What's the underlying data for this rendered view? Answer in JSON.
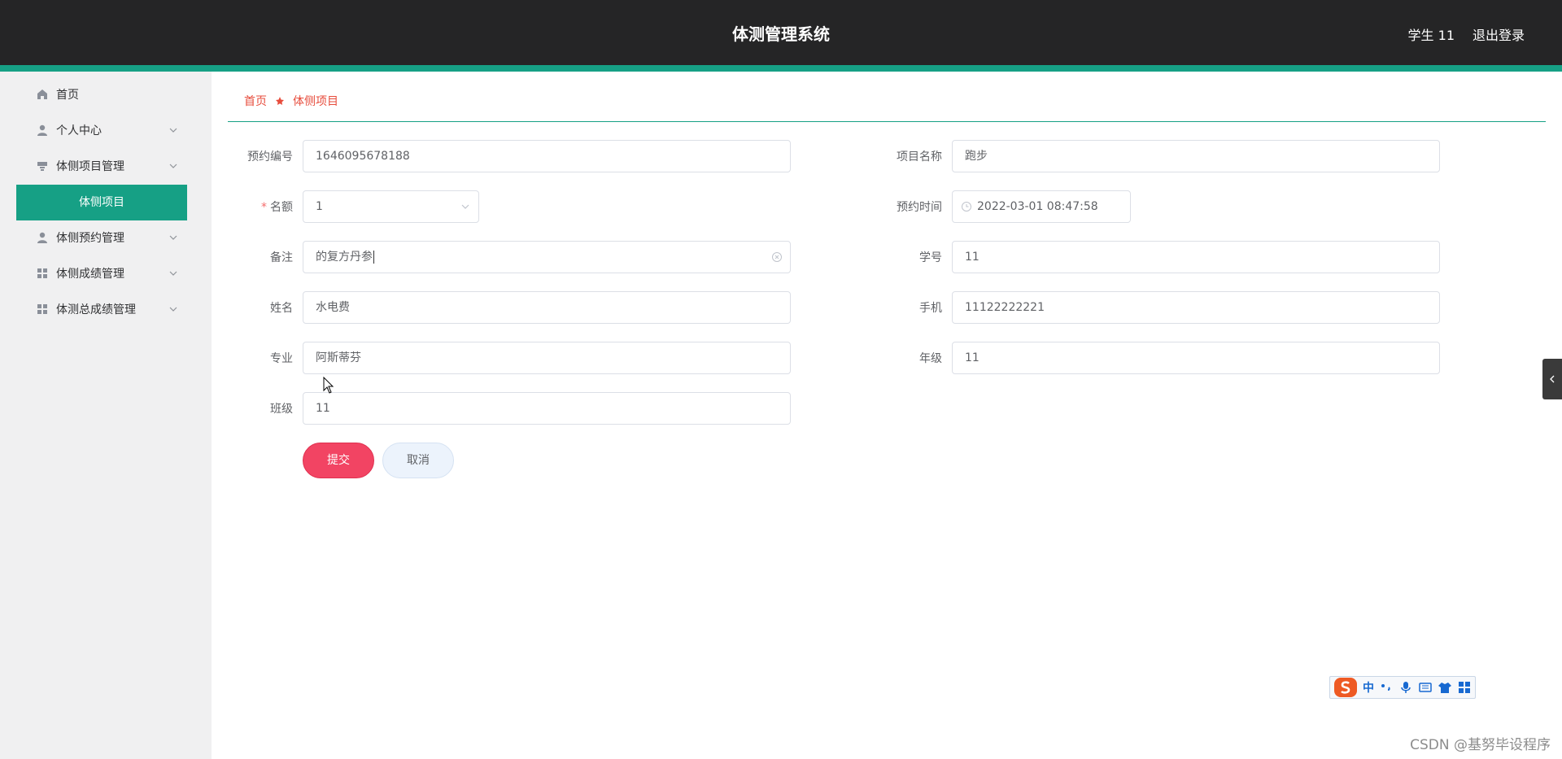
{
  "header": {
    "title": "体测管理系统",
    "user": "学生 11",
    "logout": "退出登录"
  },
  "sidebar": {
    "items": [
      {
        "label": "首页",
        "icon": "home-icon"
      },
      {
        "label": "个人中心",
        "icon": "user-icon"
      },
      {
        "label": "体侧项目管理",
        "icon": "project-icon"
      },
      {
        "label": "体侧预约管理",
        "icon": "user-icon"
      },
      {
        "label": "体侧成绩管理",
        "icon": "grid-icon"
      },
      {
        "label": "体测总成绩管理",
        "icon": "grid-icon"
      }
    ],
    "active_sub": "体侧项目"
  },
  "breadcrumb": {
    "home": "首页",
    "current": "体侧项目"
  },
  "form": {
    "booking_no": {
      "label": "预约编号",
      "value": "1646095678188"
    },
    "project_name": {
      "label": "项目名称",
      "value": "跑步"
    },
    "quota": {
      "label": "名额",
      "value": "1"
    },
    "booking_time": {
      "label": "预约时间",
      "value": "2022-03-01 08:47:58"
    },
    "remark": {
      "label": "备注",
      "value": "的复方丹参"
    },
    "student_no": {
      "label": "学号",
      "value": "11"
    },
    "name": {
      "label": "姓名",
      "value": "水电费"
    },
    "phone": {
      "label": "手机",
      "value": "11122222221"
    },
    "major": {
      "label": "专业",
      "value": "阿斯蒂芬"
    },
    "grade": {
      "label": "年级",
      "value": "11"
    },
    "class": {
      "label": "班级",
      "value": "11"
    },
    "required_mark": "*"
  },
  "buttons": {
    "submit": "提交",
    "cancel": "取消"
  },
  "ime": {
    "mode": "中"
  },
  "watermark": "CSDN @基努毕设程序",
  "colors": {
    "accent": "#16a085",
    "header_bg": "#252526",
    "submit": "#f24463",
    "breadcrumb": "#e74c3c"
  }
}
